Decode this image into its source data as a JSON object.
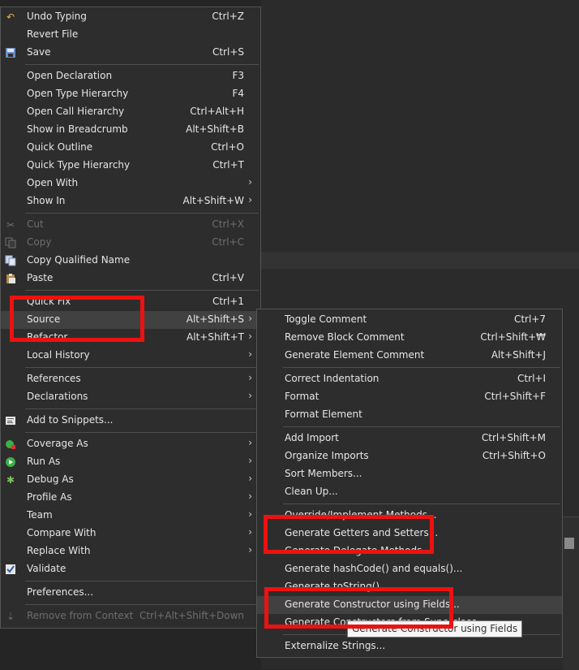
{
  "main_menu": {
    "items": [
      {
        "label": "Undo Typing",
        "shortcut": "Ctrl+Z",
        "icon": "undo-icon"
      },
      {
        "label": "Revert File",
        "shortcut": ""
      },
      {
        "label": "Save",
        "shortcut": "Ctrl+S",
        "icon": "save-icon"
      },
      {
        "label": "Open Declaration",
        "shortcut": "F3"
      },
      {
        "label": "Open Type Hierarchy",
        "shortcut": "F4"
      },
      {
        "label": "Open Call Hierarchy",
        "shortcut": "Ctrl+Alt+H"
      },
      {
        "label": "Show in Breadcrumb",
        "shortcut": "Alt+Shift+B"
      },
      {
        "label": "Quick Outline",
        "shortcut": "Ctrl+O"
      },
      {
        "label": "Quick Type Hierarchy",
        "shortcut": "Ctrl+T"
      },
      {
        "label": "Open With",
        "shortcut": ""
      },
      {
        "label": "Show In",
        "shortcut": "Alt+Shift+W"
      },
      {
        "label": "Cut",
        "shortcut": "Ctrl+X",
        "icon": "cut-icon",
        "disabled": true
      },
      {
        "label": "Copy",
        "shortcut": "Ctrl+C",
        "icon": "copy-icon",
        "disabled": true
      },
      {
        "label": "Copy Qualified Name",
        "shortcut": "",
        "icon": "copy-qualified-icon"
      },
      {
        "label": "Paste",
        "shortcut": "Ctrl+V",
        "icon": "paste-icon"
      },
      {
        "label": "Quick Fix",
        "shortcut": "Ctrl+1"
      },
      {
        "label": "Source",
        "shortcut": "Alt+Shift+S"
      },
      {
        "label": "Refactor",
        "shortcut": "Alt+Shift+T"
      },
      {
        "label": "Local History",
        "shortcut": ""
      },
      {
        "label": "References",
        "shortcut": ""
      },
      {
        "label": "Declarations",
        "shortcut": ""
      },
      {
        "label": "Add to Snippets...",
        "shortcut": "",
        "icon": "snippets-icon"
      },
      {
        "label": "Coverage As",
        "shortcut": "",
        "icon": "coverage-icon"
      },
      {
        "label": "Run As",
        "shortcut": "",
        "icon": "run-icon"
      },
      {
        "label": "Debug As",
        "shortcut": "",
        "icon": "debug-icon"
      },
      {
        "label": "Profile As",
        "shortcut": ""
      },
      {
        "label": "Team",
        "shortcut": ""
      },
      {
        "label": "Compare With",
        "shortcut": ""
      },
      {
        "label": "Replace With",
        "shortcut": ""
      },
      {
        "label": "Validate",
        "shortcut": "",
        "icon": "checkbox-icon"
      },
      {
        "label": "Preferences...",
        "shortcut": ""
      },
      {
        "label": "Remove from Context",
        "shortcut": "Ctrl+Alt+Shift+Down",
        "icon": "remove-context-icon",
        "disabled": true
      }
    ],
    "submenu_arrow": "›"
  },
  "source_menu": {
    "items": [
      {
        "label": "Toggle Comment",
        "shortcut": "Ctrl+7"
      },
      {
        "label": "Remove Block Comment",
        "shortcut": "Ctrl+Shift+₩"
      },
      {
        "label": "Generate Element Comment",
        "shortcut": "Alt+Shift+J"
      },
      {
        "label": "Correct Indentation",
        "shortcut": "Ctrl+I"
      },
      {
        "label": "Format",
        "shortcut": "Ctrl+Shift+F"
      },
      {
        "label": "Format Element",
        "shortcut": ""
      },
      {
        "label": "Add Import",
        "shortcut": "Ctrl+Shift+M"
      },
      {
        "label": "Organize Imports",
        "shortcut": "Ctrl+Shift+O"
      },
      {
        "label": "Sort Members...",
        "shortcut": ""
      },
      {
        "label": "Clean Up...",
        "shortcut": ""
      },
      {
        "label": "Override/Implement Methods...",
        "shortcut": ""
      },
      {
        "label": "Generate Getters and Setters...",
        "shortcut": ""
      },
      {
        "label": "Generate Delegate Methods...",
        "shortcut": ""
      },
      {
        "label": "Generate hashCode() and equals()...",
        "shortcut": ""
      },
      {
        "label": "Generate toString()...",
        "shortcut": ""
      },
      {
        "label": "Generate Constructor using Fields...",
        "shortcut": ""
      },
      {
        "label": "Generate Constructors from Superclass...",
        "shortcut": ""
      },
      {
        "label": "Externalize Strings...",
        "shortcut": ""
      }
    ]
  },
  "tooltip": {
    "text": "Generate Constructor using Fields"
  },
  "colors": {
    "highlight_box": "#ee1111",
    "menu_bg": "#2d2d2d",
    "hover_bg": "#414141",
    "text": "#e6e6e6",
    "disabled_text": "#6e6e6e"
  }
}
